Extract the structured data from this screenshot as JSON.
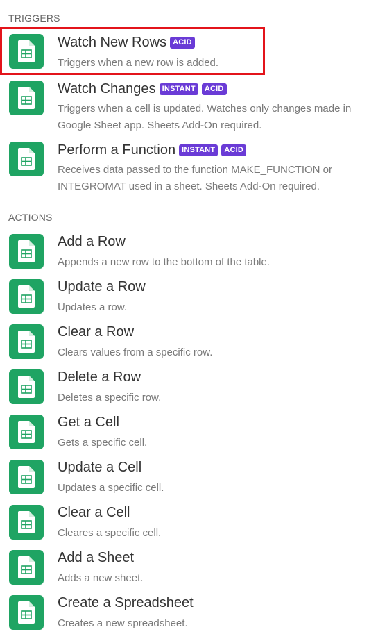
{
  "colors": {
    "icon_green": "#1fa463",
    "badge_purple": "#6a3bd6",
    "highlight_red": "#e3141b"
  },
  "triggers": {
    "header": "TRIGGERS",
    "items": [
      {
        "title": "Watch New Rows",
        "badges": [
          "ACID"
        ],
        "desc": "Triggers when a new row is added.",
        "icon": "google-sheets-icon",
        "highlighted": true
      },
      {
        "title": "Watch Changes",
        "badges": [
          "INSTANT",
          "ACID"
        ],
        "desc": "Triggers when a cell is updated. Watches only changes made in Google Sheet app. Sheets Add-On required.",
        "icon": "google-sheets-icon"
      },
      {
        "title": "Perform a Function",
        "badges": [
          "INSTANT",
          "ACID"
        ],
        "desc": "Receives data passed to the function MAKE_FUNCTION or INTEGROMAT used in a sheet. Sheets Add-On required.",
        "icon": "google-sheets-icon"
      }
    ]
  },
  "actions": {
    "header": "ACTIONS",
    "items": [
      {
        "title": "Add a Row",
        "desc": "Appends a new row to the bottom of the table.",
        "icon": "google-sheets-icon"
      },
      {
        "title": "Update a Row",
        "desc": "Updates a row.",
        "icon": "google-sheets-icon"
      },
      {
        "title": "Clear a Row",
        "desc": "Clears values from a specific row.",
        "icon": "google-sheets-icon"
      },
      {
        "title": "Delete a Row",
        "desc": "Deletes a specific row.",
        "icon": "google-sheets-icon"
      },
      {
        "title": "Get a Cell",
        "desc": "Gets a specific cell.",
        "icon": "google-sheets-icon"
      },
      {
        "title": "Update a Cell",
        "desc": "Updates a specific cell.",
        "icon": "google-sheets-icon"
      },
      {
        "title": "Clear a Cell",
        "desc": "Cleares a specific cell.",
        "icon": "google-sheets-icon"
      },
      {
        "title": "Add a Sheet",
        "desc": "Adds a new sheet.",
        "icon": "google-sheets-icon"
      },
      {
        "title": "Create a Spreadsheet",
        "desc": "Creates a new spreadsheet.",
        "icon": "google-sheets-icon"
      }
    ]
  }
}
